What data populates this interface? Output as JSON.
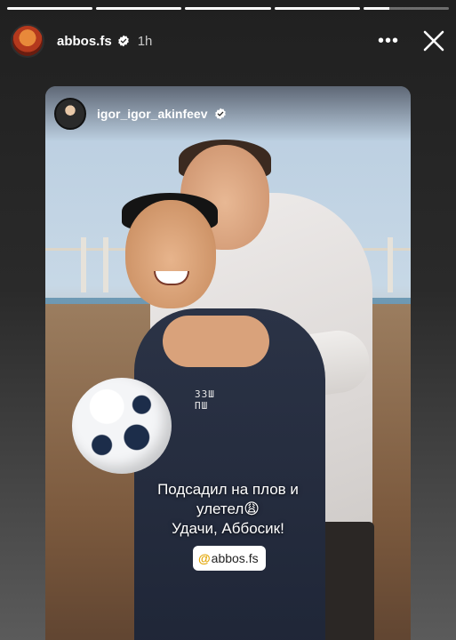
{
  "story": {
    "progress_segments": [
      1,
      1,
      1,
      1,
      0.3
    ],
    "header": {
      "username": "abbos.fs",
      "time": "1h",
      "more_icon": "•••"
    },
    "shared_post": {
      "username": "igor_igor_akinfeev",
      "caption_lines": [
        "Подсадил на плов и",
        "улетел😩",
        "Удачи, Аббосик!"
      ],
      "mention_at": "@",
      "mention_user": "abbos.fs",
      "jacket_print": "33Ш\nПШ"
    }
  },
  "colors": {
    "verified": "#3897f0",
    "mention_at": "#e2a400"
  }
}
